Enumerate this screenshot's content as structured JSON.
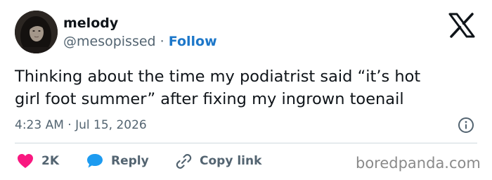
{
  "author": {
    "display_name": "melody",
    "handle": "@mesopissed",
    "separator": "·",
    "follow_label": "Follow"
  },
  "tweet": {
    "text_line_1": "Thinking about the time my podiatrist said “it’s hot",
    "text_line_2": "girl foot summer” after fixing my ingrown toenail",
    "timestamp": "4:23 AM · Jul 15, 2026"
  },
  "actions": {
    "like_count": "2K",
    "reply_label": "Reply",
    "copy_link_label": "Copy link"
  },
  "watermark": "boredpanda.com",
  "icons": {
    "brand": "x-logo-icon",
    "info": "info-icon",
    "like": "heart-icon",
    "reply": "speech-bubble-icon",
    "copy_link": "link-icon"
  },
  "colors": {
    "heart": "#f91880",
    "reply_bubble": "#1d9bf0",
    "follow_link": "#1d77c9",
    "secondary_text": "#536471",
    "primary_text": "#0f1419",
    "divider": "#cfd9de"
  }
}
